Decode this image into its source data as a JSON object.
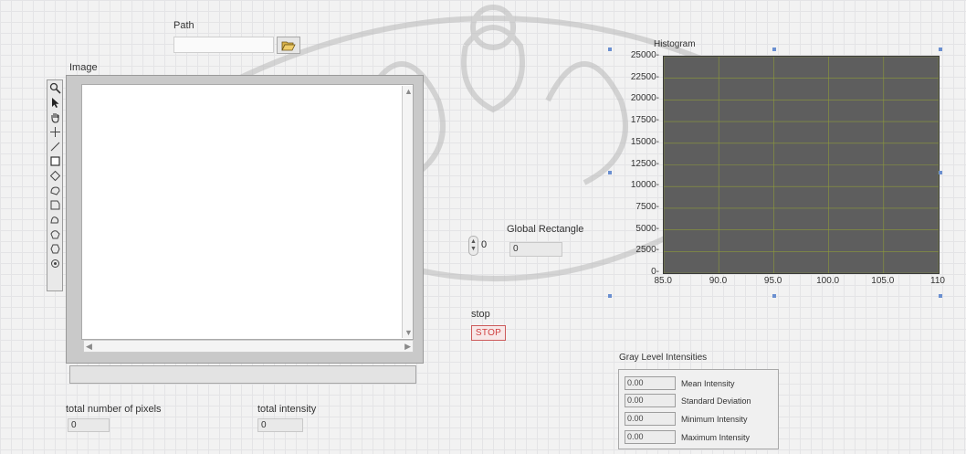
{
  "path": {
    "label": "Path",
    "value": "",
    "icons": {
      "browse": "folder-open-icon"
    }
  },
  "image_display": {
    "label": "Image",
    "tools": [
      "zoom-icon",
      "pointer-icon",
      "pan-icon",
      "crosshair-icon",
      "line-icon",
      "rectangle-icon",
      "rotated-rectangle-icon",
      "oval-icon",
      "polygon-icon",
      "freehand-icon",
      "annulus-icon",
      "broken-line-icon",
      "point-icon"
    ]
  },
  "numeric_control": {
    "value": "0"
  },
  "global_rectangle": {
    "label": "Global Rectangle",
    "value": "0"
  },
  "stop": {
    "label": "stop",
    "button": "STOP"
  },
  "histogram": {
    "label": "Histogram",
    "y_ticks": [
      "25000",
      "22500",
      "20000",
      "17500",
      "15000",
      "12500",
      "10000",
      "7500",
      "5000",
      "2500",
      "0"
    ],
    "x_ticks": [
      "85.0",
      "90.0",
      "95.0",
      "100.0",
      "105.0",
      "110"
    ]
  },
  "chart_data": {
    "type": "line",
    "title": "Histogram",
    "xlim": [
      85,
      110
    ],
    "ylim": [
      0,
      25000
    ],
    "x_ticks": [
      85,
      90,
      95,
      100,
      105,
      110
    ],
    "y_ticks": [
      0,
      2500,
      5000,
      7500,
      10000,
      12500,
      15000,
      17500,
      20000,
      22500,
      25000
    ],
    "grid": true,
    "series": []
  },
  "totals": {
    "pixels_label": "total number of pixels",
    "pixels_value": "0",
    "intensity_label": "total intensity",
    "intensity_value": "0"
  },
  "gray_level": {
    "title": "Gray Level Intensities",
    "rows": [
      {
        "value": "0.00",
        "label": "Mean Intensity"
      },
      {
        "value": "0.00",
        "label": "Standard Deviation"
      },
      {
        "value": "0.00",
        "label": "Minimum Intensity"
      },
      {
        "value": "0.00",
        "label": "Maximum Intensity"
      }
    ]
  },
  "colors": {
    "plot_background": "#5e5e5e",
    "plot_grid": "#8d9a3a",
    "stop_text": "#d04040",
    "selection_handle": "#6a8fd0"
  }
}
